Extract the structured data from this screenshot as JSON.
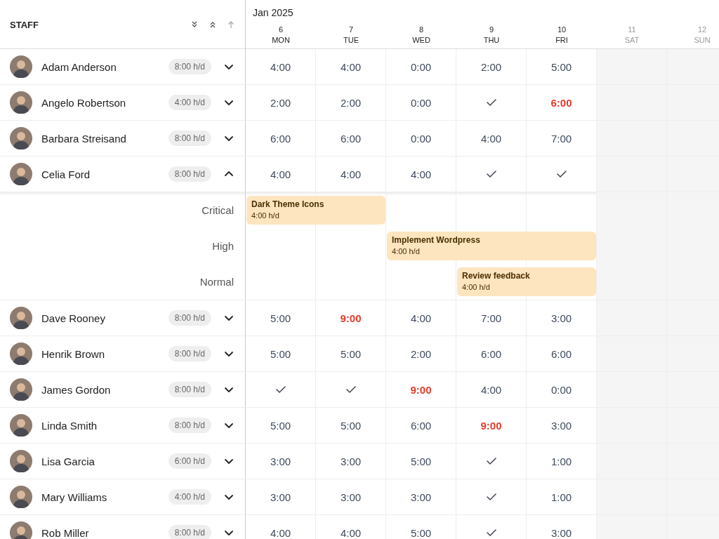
{
  "staff_header": {
    "title": "STAFF"
  },
  "calendar": {
    "month": "Jan 2025",
    "days": [
      {
        "date": "6",
        "day": "MON",
        "weekend": false
      },
      {
        "date": "7",
        "day": "TUE",
        "weekend": false
      },
      {
        "date": "8",
        "day": "WED",
        "weekend": false
      },
      {
        "date": "9",
        "day": "THU",
        "weekend": false
      },
      {
        "date": "10",
        "day": "FRI",
        "weekend": false
      },
      {
        "date": "11",
        "day": "SAT",
        "weekend": true
      },
      {
        "date": "12",
        "day": "SUN",
        "weekend": true
      }
    ]
  },
  "staff": [
    {
      "name": "Adam Anderson",
      "rate": "8:00 h/d",
      "expanded": false,
      "cells": [
        {
          "kind": "hours",
          "text": "4:00",
          "over": false
        },
        {
          "kind": "hours",
          "text": "4:00",
          "over": false
        },
        {
          "kind": "hours",
          "text": "0:00",
          "over": false
        },
        {
          "kind": "hours",
          "text": "2:00",
          "over": false
        },
        {
          "kind": "hours",
          "text": "5:00",
          "over": false
        }
      ]
    },
    {
      "name": "Angelo Robertson",
      "rate": "4:00 h/d",
      "expanded": false,
      "cells": [
        {
          "kind": "hours",
          "text": "2:00",
          "over": false
        },
        {
          "kind": "hours",
          "text": "2:00",
          "over": false
        },
        {
          "kind": "hours",
          "text": "0:00",
          "over": false
        },
        {
          "kind": "done"
        },
        {
          "kind": "hours",
          "text": "6:00",
          "over": true
        }
      ]
    },
    {
      "name": "Barbara Streisand",
      "rate": "8:00 h/d",
      "expanded": false,
      "cells": [
        {
          "kind": "hours",
          "text": "6:00",
          "over": false
        },
        {
          "kind": "hours",
          "text": "6:00",
          "over": false
        },
        {
          "kind": "hours",
          "text": "0:00",
          "over": false
        },
        {
          "kind": "hours",
          "text": "4:00",
          "over": false
        },
        {
          "kind": "hours",
          "text": "7:00",
          "over": false
        }
      ]
    },
    {
      "name": "Celia Ford",
      "rate": "8:00 h/d",
      "expanded": true,
      "cells": [
        {
          "kind": "hours",
          "text": "4:00",
          "over": false
        },
        {
          "kind": "hours",
          "text": "4:00",
          "over": false
        },
        {
          "kind": "hours",
          "text": "4:00",
          "over": false
        },
        {
          "kind": "done"
        },
        {
          "kind": "done"
        }
      ],
      "lanes": [
        {
          "priority": "Critical",
          "title": "Dark Theme Icons",
          "rate": "4:00 h/d",
          "days": [
            true,
            true,
            false,
            false,
            false,
            false,
            false
          ]
        },
        {
          "priority": "High",
          "title": "Implement Wordpress",
          "rate": "4:00 h/d",
          "days": [
            false,
            false,
            true,
            true,
            true,
            false,
            false
          ]
        },
        {
          "priority": "Normal",
          "title": "Review feedback",
          "rate": "4:00 h/d",
          "days": [
            false,
            false,
            false,
            true,
            true,
            false,
            false
          ]
        }
      ]
    },
    {
      "name": "Dave Rooney",
      "rate": "8:00 h/d",
      "expanded": false,
      "cells": [
        {
          "kind": "hours",
          "text": "5:00",
          "over": false
        },
        {
          "kind": "hours",
          "text": "9:00",
          "over": true
        },
        {
          "kind": "hours",
          "text": "4:00",
          "over": false
        },
        {
          "kind": "hours",
          "text": "7:00",
          "over": false
        },
        {
          "kind": "hours",
          "text": "3:00",
          "over": false
        }
      ]
    },
    {
      "name": "Henrik Brown",
      "rate": "8:00 h/d",
      "expanded": false,
      "cells": [
        {
          "kind": "hours",
          "text": "5:00",
          "over": false
        },
        {
          "kind": "hours",
          "text": "5:00",
          "over": false
        },
        {
          "kind": "hours",
          "text": "2:00",
          "over": false
        },
        {
          "kind": "hours",
          "text": "6:00",
          "over": false
        },
        {
          "kind": "hours",
          "text": "6:00",
          "over": false
        }
      ]
    },
    {
      "name": "James Gordon",
      "rate": "8:00 h/d",
      "expanded": false,
      "cells": [
        {
          "kind": "done"
        },
        {
          "kind": "done"
        },
        {
          "kind": "hours",
          "text": "9:00",
          "over": true
        },
        {
          "kind": "hours",
          "text": "4:00",
          "over": false
        },
        {
          "kind": "hours",
          "text": "0:00",
          "over": false
        }
      ]
    },
    {
      "name": "Linda Smith",
      "rate": "8:00 h/d",
      "expanded": false,
      "cells": [
        {
          "kind": "hours",
          "text": "5:00",
          "over": false
        },
        {
          "kind": "hours",
          "text": "5:00",
          "over": false
        },
        {
          "kind": "hours",
          "text": "6:00",
          "over": false
        },
        {
          "kind": "hours",
          "text": "9:00",
          "over": true
        },
        {
          "kind": "hours",
          "text": "3:00",
          "over": false
        }
      ]
    },
    {
      "name": "Lisa Garcia",
      "rate": "6:00 h/d",
      "expanded": false,
      "cells": [
        {
          "kind": "hours",
          "text": "3:00",
          "over": false
        },
        {
          "kind": "hours",
          "text": "3:00",
          "over": false
        },
        {
          "kind": "hours",
          "text": "5:00",
          "over": false
        },
        {
          "kind": "done"
        },
        {
          "kind": "hours",
          "text": "1:00",
          "over": false
        }
      ]
    },
    {
      "name": "Mary Williams",
      "rate": "4:00 h/d",
      "expanded": false,
      "cells": [
        {
          "kind": "hours",
          "text": "3:00",
          "over": false
        },
        {
          "kind": "hours",
          "text": "3:00",
          "over": false
        },
        {
          "kind": "hours",
          "text": "3:00",
          "over": false
        },
        {
          "kind": "done"
        },
        {
          "kind": "hours",
          "text": "1:00",
          "over": false
        }
      ]
    },
    {
      "name": "Rob Miller",
      "rate": "8:00 h/d",
      "expanded": false,
      "cells": [
        {
          "kind": "hours",
          "text": "4:00",
          "over": false
        },
        {
          "kind": "hours",
          "text": "4:00",
          "over": false
        },
        {
          "kind": "hours",
          "text": "5:00",
          "over": false
        },
        {
          "kind": "done"
        },
        {
          "kind": "hours",
          "text": "3:00",
          "over": false
        }
      ]
    }
  ]
}
